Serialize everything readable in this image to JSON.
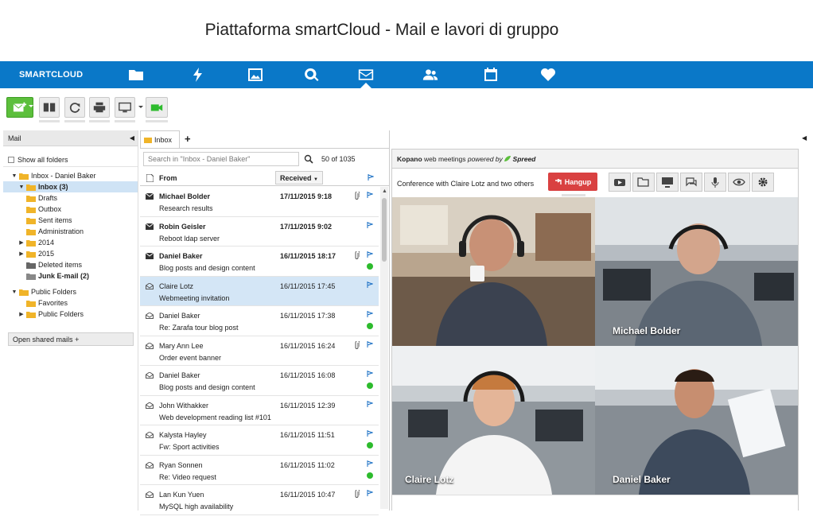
{
  "page_title": "Piattaforma smartCloud - Mail e lavori di gruppo",
  "brand": "SMARTCLOUD",
  "nav_icons": [
    "folder-icon",
    "lightning-icon",
    "image-icon",
    "search-icon",
    "mail-icon",
    "contacts-icon",
    "calendar-icon",
    "heart-icon"
  ],
  "colors": {
    "brand_blue": "#0a78c8",
    "hangup_red": "#d94141",
    "online_green": "#2dbb2d",
    "selection": "#d4e6f6"
  },
  "left_pane": {
    "header": "Mail",
    "show_all_folders": "Show all folders",
    "tree": [
      {
        "label": "Inbox - Daniel Baker",
        "level": 0,
        "expanded": true,
        "bold": false,
        "icon": "inbox-root-icon"
      },
      {
        "label": "Inbox (3)",
        "level": 1,
        "expanded": true,
        "bold": true,
        "selected": true,
        "icon": "inbox-icon"
      },
      {
        "label": "Drafts",
        "level": 1,
        "bold": false,
        "icon": "drafts-icon"
      },
      {
        "label": "Outbox",
        "level": 1,
        "bold": false,
        "icon": "outbox-icon"
      },
      {
        "label": "Sent items",
        "level": 1,
        "bold": false,
        "icon": "sent-icon"
      },
      {
        "label": "Administration",
        "level": 1,
        "bold": false,
        "icon": "folder-icon"
      },
      {
        "label": "2014",
        "level": 1,
        "collapsed": true,
        "bold": false,
        "icon": "folder-icon"
      },
      {
        "label": "2015",
        "level": 1,
        "collapsed": true,
        "bold": false,
        "icon": "folder-icon"
      },
      {
        "label": "Deleted items",
        "level": 1,
        "bold": false,
        "icon": "trash-icon"
      },
      {
        "label": "Junk E-mail (2)",
        "level": 1,
        "bold": true,
        "icon": "junk-icon"
      },
      {
        "label": "Public Folders",
        "level": 0,
        "expanded": true,
        "bold": false,
        "icon": "public-folders-icon",
        "gap": true
      },
      {
        "label": "Favorites",
        "level": 1,
        "bold": false,
        "icon": "favorites-icon"
      },
      {
        "label": "Public Folders",
        "level": 1,
        "collapsed": true,
        "bold": false,
        "icon": "folder-icon"
      }
    ],
    "open_shared": "Open shared mails"
  },
  "mail_list": {
    "tab": "Inbox",
    "tab_add": "+",
    "search_placeholder": "Search in \"Inbox - Daniel Baker\"",
    "count": "50 of 1035",
    "col_from": "From",
    "col_received": "Received",
    "rows": [
      {
        "from": "Michael Bolder",
        "subject": "Research results",
        "date": "17/11/2015 9:18",
        "unread": true,
        "attach": true,
        "online": false
      },
      {
        "from": "Robin Geisler",
        "subject": "Reboot ldap server",
        "date": "17/11/2015 9:02",
        "unread": true,
        "attach": false,
        "online": false
      },
      {
        "from": "Daniel Baker",
        "subject": "Blog posts and design content",
        "date": "16/11/2015 18:17",
        "unread": true,
        "attach": true,
        "online": true
      },
      {
        "from": "Claire Lotz",
        "subject": "Webmeeting invitation",
        "date": "16/11/2015 17:45",
        "unread": false,
        "attach": false,
        "online": false,
        "selected": true
      },
      {
        "from": "Daniel Baker",
        "subject": "Re: Zarafa tour blog post",
        "date": "16/11/2015 17:38",
        "unread": false,
        "attach": false,
        "online": true
      },
      {
        "from": "Mary Ann Lee",
        "subject": "Order event banner",
        "date": "16/11/2015 16:24",
        "unread": false,
        "attach": true,
        "online": false
      },
      {
        "from": "Daniel Baker",
        "subject": "Blog posts and design content",
        "date": "16/11/2015 16:08",
        "unread": false,
        "attach": false,
        "online": true
      },
      {
        "from": "John Withakker",
        "subject": "Web development reading list #101",
        "date": "16/11/2015 12:39",
        "unread": false,
        "attach": false,
        "online": false
      },
      {
        "from": "Kalysta Hayley",
        "subject": "Fw: Sport activities",
        "date": "16/11/2015 11:51",
        "unread": false,
        "attach": false,
        "online": true
      },
      {
        "from": "Ryan Sonnen",
        "subject": "Re: Video request",
        "date": "16/11/2015 11:02",
        "unread": false,
        "attach": false,
        "online": true
      },
      {
        "from": "Lan Kun Yuen",
        "subject": "MySQL high availability",
        "date": "16/11/2015 10:47",
        "unread": false,
        "attach": true,
        "online": false
      }
    ]
  },
  "meeting": {
    "brand": "Kopano",
    "title_mid": "web meetings",
    "powered_by": "powered by",
    "engine": "Spreed",
    "conference_label": "Conference with Claire Lotz and two others",
    "hangup": "Hangup",
    "participants": [
      {
        "name": ""
      },
      {
        "name": "Michael Bolder"
      },
      {
        "name": "Claire Lotz"
      },
      {
        "name": "Daniel Baker"
      }
    ],
    "tools": [
      "youtube-icon",
      "folder-open-icon",
      "screen-share-icon",
      "chat-icon",
      "microphone-icon",
      "eye-icon",
      "gear-icon"
    ]
  }
}
